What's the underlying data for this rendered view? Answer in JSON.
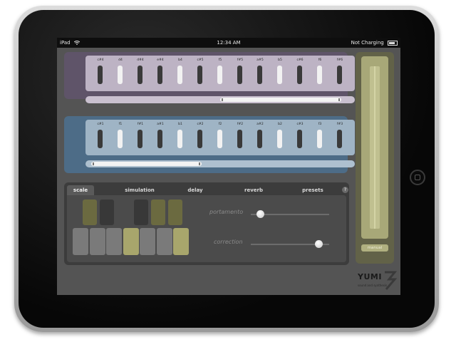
{
  "status_bar": {
    "device": "iPad",
    "time": "12:34 AM",
    "battery": "Not Charging"
  },
  "bank_top": {
    "keys": [
      {
        "label": "c#4",
        "active": false
      },
      {
        "label": "d4",
        "active": true
      },
      {
        "label": "d#4",
        "active": false
      },
      {
        "label": "e#4",
        "active": false
      },
      {
        "label": "b4",
        "active": true
      },
      {
        "label": "c#5",
        "active": false
      },
      {
        "label": "f5",
        "active": true
      },
      {
        "label": "f#5",
        "active": false
      },
      {
        "label": "a#5",
        "active": false
      },
      {
        "label": "b5",
        "active": true
      },
      {
        "label": "c#6",
        "active": false
      },
      {
        "label": "f6",
        "active": true
      },
      {
        "label": "f#6",
        "active": false
      }
    ],
    "range": [
      0.5,
      0.95
    ]
  },
  "bank_bottom": {
    "keys": [
      {
        "label": "c#1",
        "active": false
      },
      {
        "label": "f1",
        "active": true
      },
      {
        "label": "f#1",
        "active": false
      },
      {
        "label": "a#1",
        "active": false
      },
      {
        "label": "b1",
        "active": true
      },
      {
        "label": "c#2",
        "active": false
      },
      {
        "label": "f2",
        "active": true
      },
      {
        "label": "f#2",
        "active": false
      },
      {
        "label": "a#2",
        "active": false
      },
      {
        "label": "b2",
        "active": true
      },
      {
        "label": "c#3",
        "active": false
      },
      {
        "label": "f3",
        "active": true
      },
      {
        "label": "f#3",
        "active": false
      }
    ],
    "range": [
      0.02,
      0.43
    ]
  },
  "tabs": [
    {
      "label": "scale",
      "active": true
    },
    {
      "label": "simulation",
      "active": false
    },
    {
      "label": "delay",
      "active": false
    },
    {
      "label": "reverb",
      "active": false
    },
    {
      "label": "presets",
      "active": false
    }
  ],
  "help_label": "?",
  "scale": {
    "black_keys": [
      true,
      false,
      false,
      true,
      true
    ],
    "white_keys": [
      false,
      false,
      false,
      true,
      false,
      false,
      true
    ]
  },
  "params": [
    {
      "label": "portamento",
      "value": 0.12
    },
    {
      "label": "correction",
      "value": 0.86
    }
  ],
  "manual": {
    "button_label": "manual"
  },
  "logo": {
    "main": "YUMI",
    "sub": "sound and synthesis"
  },
  "colors": {
    "screen_bg": "#545454",
    "bank_top": "#5f5469",
    "bank_bottom": "#4d6c87",
    "scale_active": "#a8a66c",
    "manual_strip": "#626248"
  }
}
